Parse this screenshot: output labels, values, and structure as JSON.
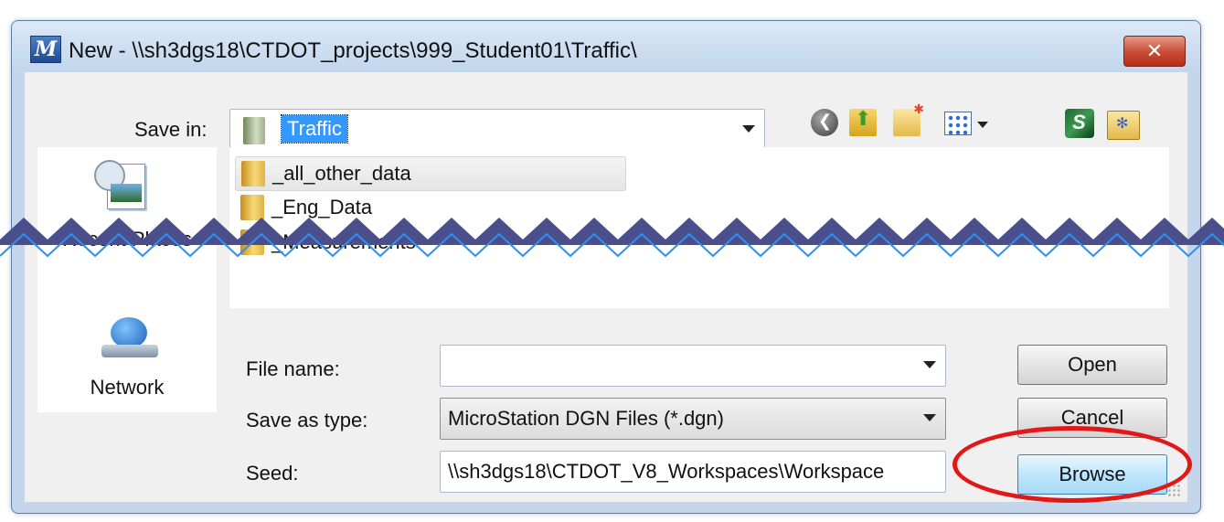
{
  "window": {
    "title": "New - \\\\sh3dgs18\\CTDOT_projects\\999_Student01\\Traffic\\",
    "close_glyph": "✕",
    "app_icon_glyph": "M"
  },
  "save_in": {
    "label": "Save in:",
    "value": "Traffic"
  },
  "places": [
    {
      "label": "Recent Places"
    },
    {
      "label": "Network"
    }
  ],
  "file_list": {
    "items": [
      {
        "name": "_all_other_data"
      },
      {
        "name": "_Eng_Data"
      },
      {
        "name": "_Measurements"
      }
    ]
  },
  "form": {
    "file_name_label": "File name:",
    "file_name_value": "",
    "save_type_label": "Save as type:",
    "save_type_value": "MicroStation DGN Files (*.dgn)",
    "seed_label": "Seed:",
    "seed_value": "\\\\sh3dgs18\\CTDOT_V8_Workspaces\\Workspace"
  },
  "buttons": {
    "open": "Open",
    "cancel": "Cancel",
    "browse": "Browse"
  },
  "colors": {
    "highlight_ring": "#e21818",
    "selection": "#3399ff",
    "break_fill": "#4a4f8c",
    "break_line": "#2f8ff0"
  }
}
